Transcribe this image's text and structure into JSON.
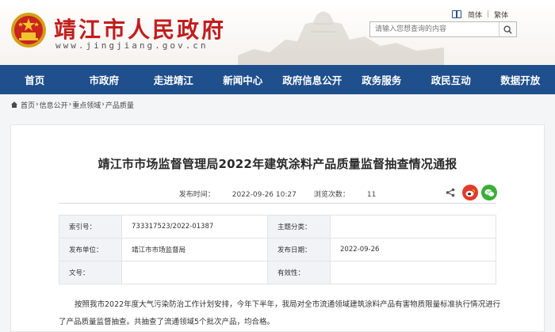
{
  "header": {
    "site_title": "靖江市人民政府",
    "domain": "www.jingjiang.gov.cn",
    "lang_simplified": "简体",
    "lang_traditional": "繁体",
    "search_placeholder": "请输入您想查询的内容"
  },
  "nav": {
    "items": [
      {
        "label": "首页"
      },
      {
        "label": "市政府"
      },
      {
        "label": "走进靖江"
      },
      {
        "label": "新闻中心"
      },
      {
        "label": "政府信息公开"
      },
      {
        "label": "政务服务"
      },
      {
        "label": "政民互动"
      },
      {
        "label": "数据开放"
      }
    ]
  },
  "breadcrumb": [
    "首页",
    "信息公开",
    "重点领域",
    "产品质量"
  ],
  "article": {
    "title": "靖江市市场监督管理局2022年建筑涂料产品质量监督抽查情况通报",
    "publish_label": "发布时间：",
    "publish_time": "2022-09-26 10:27",
    "views_label": "浏览次数：",
    "views": "11",
    "info": {
      "index_label": "索引号：",
      "index_value": "733317523/2022-01387",
      "topic_label": "主题分类：",
      "topic_value": "",
      "publisher_label": "发布单位：",
      "publisher_value": "靖江市市场监督局",
      "date_label": "发布日期：",
      "date_value": "2022-09-26",
      "docno_label": "文号：",
      "docno_value": "",
      "validity_label": "有效性：",
      "validity_value": ""
    },
    "body": "按照我市2022年度大气污染防治工作计划安排，今年下半年，我局对全市流通领域建筑涂料产品有害物质限量标准执行情况进行了产品质量监督抽查。共抽查了流通领域5个批次产品，均合格。"
  },
  "colors": {
    "brand_red": "#c21d1d",
    "nav_blue": "#1f4f8c",
    "weibo_red": "#e23b2a",
    "wechat_green": "#3cae3a"
  },
  "icons": [
    "national-emblem-icon",
    "lang-switch-icon",
    "search-icon",
    "home-icon",
    "share-icon",
    "weibo-icon",
    "wechat-icon"
  ]
}
